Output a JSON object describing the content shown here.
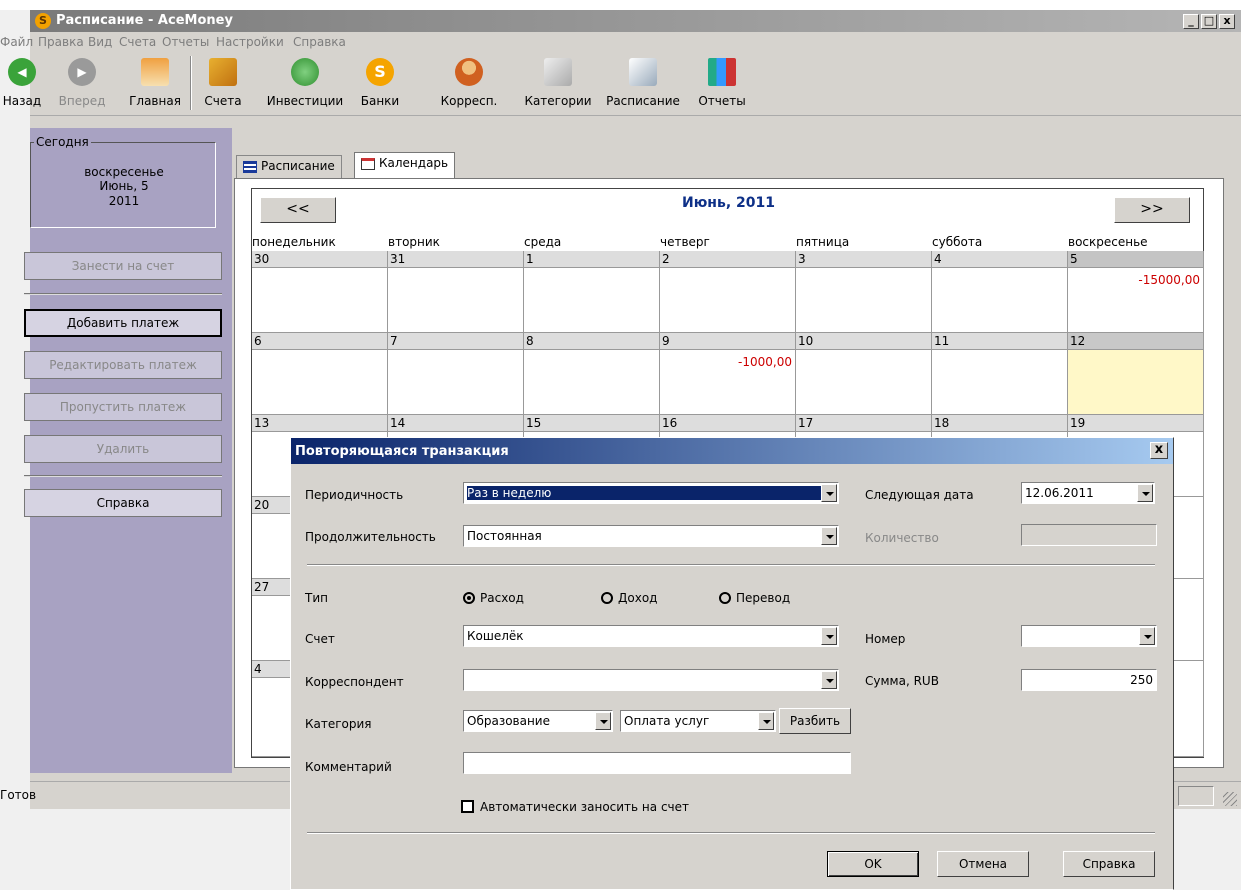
{
  "window": {
    "title": "Расписание - AceMoney",
    "app_icon": "S",
    "minimize": "_",
    "maximize": "□",
    "close": "x"
  },
  "menu": [
    "Файл",
    "Правка",
    "Вид",
    "Счета",
    "Отчеты",
    "Настройки",
    "Справка"
  ],
  "toolbar": {
    "back": "Назад",
    "forward": "Вперед",
    "home": "Главная",
    "accounts": "Счета",
    "investments": "Инвестиции",
    "banks": "Банки",
    "payees": "Корресп.",
    "categories": "Категории",
    "schedule": "Расписание",
    "reports": "Отчеты"
  },
  "sidebar": {
    "today_label": "Сегодня",
    "weekday": "воскресенье",
    "date": "Июнь, 5",
    "year": "2011",
    "btn_enter": "Занести на счет",
    "btn_add": "Добавить платеж",
    "btn_edit": "Редактировать платеж",
    "btn_skip": "Пропустить платеж",
    "btn_delete": "Удалить",
    "btn_help": "Справка"
  },
  "tabs": {
    "schedule": "Расписание",
    "calendar": "Календарь"
  },
  "calendar": {
    "prev": "<<",
    "next": ">>",
    "title": "Июнь, 2011",
    "days": [
      "понедельник",
      "вторник",
      "среда",
      "четверг",
      "пятница",
      "суббота",
      "воскресенье"
    ],
    "weeks": [
      [
        "30",
        "31",
        "1",
        "2",
        "3",
        "4",
        "5"
      ],
      [
        "6",
        "7",
        "8",
        "9",
        "10",
        "11",
        "12"
      ],
      [
        "13",
        "14",
        "15",
        "16",
        "17",
        "18",
        "19"
      ],
      [
        "20"
      ],
      [
        "27"
      ],
      [
        "4"
      ]
    ],
    "amounts": {
      "jun5": "-15000,00",
      "jun9": "-1000,00"
    }
  },
  "status": {
    "text": "Готов"
  },
  "dialog": {
    "title": "Повторяющаяся транзакция",
    "close": "x",
    "frequency_label": "Периодичность",
    "frequency_value": "Раз в неделю",
    "next_date_label": "Следующая дата",
    "next_date_value": "12.06.2011",
    "duration_label": "Продолжительность",
    "duration_value": "Постоянная",
    "count_label": "Количество",
    "count_value": "",
    "type_label": "Тип",
    "type_expense": "Расход",
    "type_income": "Доход",
    "type_transfer": "Перевод",
    "account_label": "Счет",
    "account_value": "Кошелёк",
    "number_label": "Номер",
    "number_value": "",
    "payee_label": "Корреспондент",
    "payee_value": "",
    "amount_label": "Сумма, RUB",
    "amount_value": "250",
    "category_label": "Категория",
    "category_value": "Образование",
    "subcategory_value": "Оплата услуг",
    "split_button": "Разбить",
    "comment_label": "Комментарий",
    "comment_value": "",
    "auto_enter_label": "Автоматически заносить на счет",
    "ok": "OK",
    "cancel": "Отмена",
    "help": "Справка"
  }
}
